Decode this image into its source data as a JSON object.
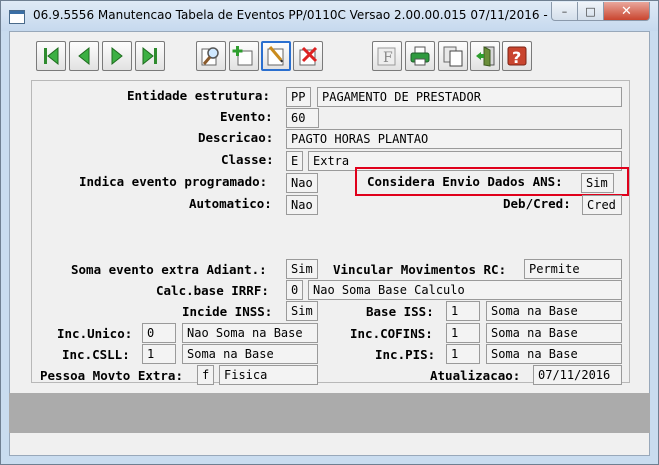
{
  "window": {
    "title": "06.9.5556 Manutencao  Tabela de Eventos PP/0110C Versao 2.00.00.015 07/11/2016 - 16:01",
    "icon": "app-icon",
    "controls": {
      "minimize": "–",
      "maximize": "□",
      "close": "✕"
    }
  },
  "toolbar": {
    "buttons": [
      {
        "name": "first-record-button",
        "icon": "first-record-icon"
      },
      {
        "name": "previous-record-button",
        "icon": "previous-record-icon"
      },
      {
        "name": "next-record-button",
        "icon": "next-record-icon"
      },
      {
        "name": "last-record-button",
        "icon": "last-record-icon"
      },
      {
        "name": "search-button",
        "icon": "search-icon"
      },
      {
        "name": "add-button",
        "icon": "add-icon"
      },
      {
        "name": "edit-button",
        "icon": "edit-icon"
      },
      {
        "name": "delete-button",
        "icon": "delete-icon"
      },
      {
        "name": "filter-button",
        "icon": "filter-icon",
        "glyph": "F"
      },
      {
        "name": "print-button",
        "icon": "printer-icon"
      },
      {
        "name": "copy-button",
        "icon": "copy-icon"
      },
      {
        "name": "exit-button",
        "icon": "exit-door-icon"
      },
      {
        "name": "help-button",
        "icon": "help-icon",
        "glyph": "?"
      }
    ]
  },
  "form": {
    "entidade_estrutura": {
      "label": "Entidade estrutura:",
      "code": "PP",
      "value": "PAGAMENTO DE PRESTADOR"
    },
    "evento": {
      "label": "Evento:",
      "value": "60"
    },
    "descricao": {
      "label": "Descricao:",
      "value": "PAGTO HORAS PLANTAO"
    },
    "classe": {
      "label": "Classe:",
      "code": "E",
      "value": "Extra"
    },
    "indica_evento_programado": {
      "label": "Indica evento programado:",
      "value": "Nao"
    },
    "considera_envio_dados_ans": {
      "label": "Considera Envio Dados ANS:",
      "value": "Sim",
      "highlight_color": "#e0001b"
    },
    "automatico": {
      "label": "Automatico:",
      "value": "Nao"
    },
    "deb_cred": {
      "label": "Deb/Cred:",
      "value": "Cred"
    },
    "soma_evento_extra_adiant": {
      "label": "Soma evento extra Adiant.:",
      "value": "Sim"
    },
    "vincular_movimentos_rc": {
      "label": "Vincular Movimentos RC:",
      "value": "Permite"
    },
    "calc_base_irrf": {
      "label": "Calc.base IRRF:",
      "code": "0",
      "value": "Nao Soma Base Calculo"
    },
    "incide_inss": {
      "label": "Incide INSS:",
      "value": "Sim"
    },
    "base_iss": {
      "label": "Base ISS:",
      "code": "1",
      "value": "Soma na Base"
    },
    "inc_unico": {
      "label": "Inc.Unico:",
      "code": "0",
      "value": "Nao Soma na Base"
    },
    "inc_cofins": {
      "label": "Inc.COFINS:",
      "code": "1",
      "value": "Soma na Base"
    },
    "inc_csll": {
      "label": "Inc.CSLL:",
      "code": "1",
      "value": "Soma na Base"
    },
    "inc_pis": {
      "label": "Inc.PIS:",
      "code": "1",
      "value": "Soma na Base"
    },
    "pessoa_movto_extra": {
      "label": "Pessoa Movto Extra:",
      "code": "f",
      "value": "Fisica"
    },
    "atualizacao": {
      "label": "Atualizacao:",
      "value": "07/11/2016"
    }
  }
}
